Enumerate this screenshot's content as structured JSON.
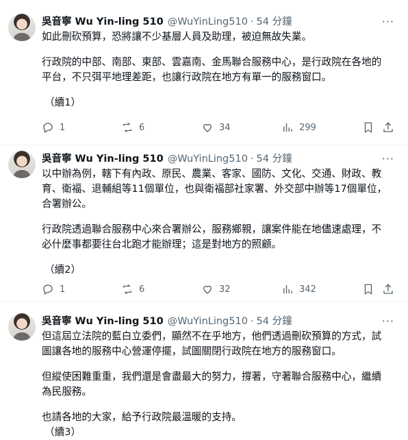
{
  "tweets": [
    {
      "display_name": "吳音寧 Wu Yin-ling 510",
      "handle": "@WuYinLing510",
      "time": "54 分鐘",
      "lines": [
        "如此刪砍預算，恐將讓不少基層人員及助理，被迫無故失業。",
        "",
        "行政院的中部、南部、東部、雲嘉南、金馬聯合服務中心，是行政院在各地的",
        "平台，不只弭平地理差距，也讓行政院在地方有單一的服務窗口。",
        "",
        "（續1）"
      ],
      "replies": "1",
      "reposts": "6",
      "likes": "34",
      "views": "299"
    },
    {
      "display_name": "吳音寧 Wu Yin-ling 510",
      "handle": "@WuYinLing510",
      "time": "54 分鐘",
      "lines": [
        "以中辦為例，轄下有內政、原民、農業、客家、國防、文化、交通、財政、教",
        "育、衛福、退輔組等11個單位，也與衛福部社家署、外交部中辦等17個單位，",
        "合署辦公。",
        "",
        "行政院透過聯合服務中心來合署辦公，服務鄉親，讓案件能在地儘速處理，不",
        "必什麼事都要往台北跑才能辦理；這是對地方的照顧。",
        "",
        "（續2）"
      ],
      "replies": "1",
      "reposts": "6",
      "likes": "32",
      "views": "342"
    },
    {
      "display_name": "吳音寧 Wu Yin-ling 510",
      "handle": "@WuYinLing510",
      "time": "54 分鐘",
      "lines": [
        "但這屆立法院的藍白立委們，顯然不在乎地方，他們透過刪砍預算的方式，試",
        "圖讓各地的服務中心營運停擺，試圖關閉行政院在地方的服務窗口。",
        "",
        "但縱使困難重重，我們還是會盡最大的努力，撐著，守著聯合服務中心，繼續",
        "為民服務。",
        "",
        "也請各地的大家，給予行政院最溫暖的支持。",
        "（續3）"
      ]
    }
  ],
  "icons": {
    "reply": "reply-icon",
    "repost": "repost-icon",
    "like": "heart-icon",
    "views": "views-icon",
    "bookmark": "bookmark-icon",
    "share": "share-icon",
    "more": "more-icon"
  }
}
